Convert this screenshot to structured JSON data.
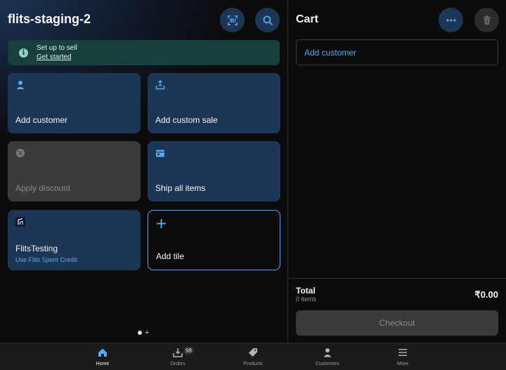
{
  "header": {
    "store_name": "flits-staging-2"
  },
  "banner": {
    "title": "Set up to sell",
    "link": "Get started"
  },
  "tiles": [
    {
      "label": "Add customer",
      "icon": "person-icon",
      "state": "enabled"
    },
    {
      "label": "Add custom sale",
      "icon": "tray-upload-icon",
      "state": "enabled"
    },
    {
      "label": "Apply discount",
      "icon": "discount-icon",
      "state": "disabled"
    },
    {
      "label": "Ship all items",
      "icon": "ship-icon",
      "state": "enabled"
    },
    {
      "label": "FlitsTesting",
      "sublabel": "Use Flits Spent Credit",
      "icon": "flits-app-icon",
      "state": "enabled"
    },
    {
      "label": "Add tile",
      "icon": "plus-icon",
      "state": "add"
    }
  ],
  "pager": {
    "plus": "+"
  },
  "cart": {
    "title": "Cart",
    "add_customer": "Add customer",
    "total_label": "Total",
    "items_label": "0 items",
    "total_value": "₹0.00",
    "checkout_label": "Checkout"
  },
  "tabbar": {
    "tabs": [
      {
        "label": "Home",
        "icon": "home-icon",
        "active": true
      },
      {
        "label": "Orders",
        "icon": "orders-icon",
        "badge": "98"
      },
      {
        "label": "Products",
        "icon": "tag-icon"
      },
      {
        "label": "Customers",
        "icon": "person-icon"
      },
      {
        "label": "More",
        "icon": "menu-icon"
      }
    ]
  },
  "colors": {
    "accent": "#5aa9ee",
    "tile": "#1d3656",
    "banner": "#17403d",
    "disabled": "#3a3a3c"
  }
}
